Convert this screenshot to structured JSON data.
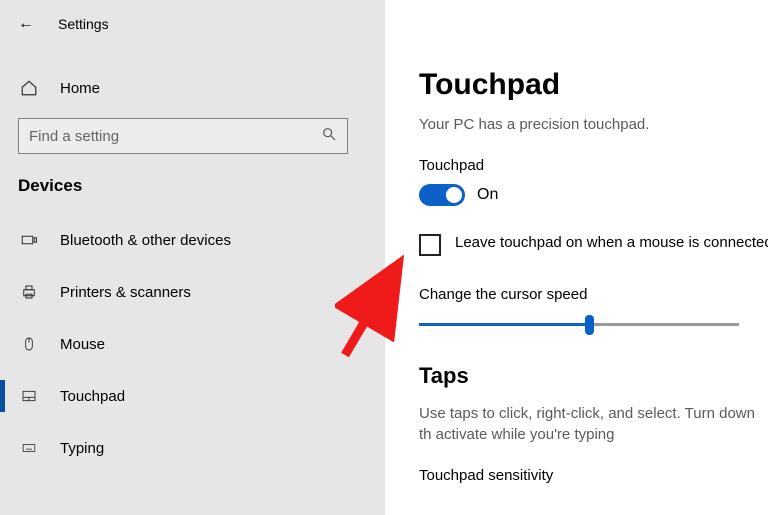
{
  "top": {
    "title": "Settings"
  },
  "home_label": "Home",
  "search": {
    "placeholder": "Find a setting"
  },
  "sidebar": {
    "section": "Devices",
    "items": [
      {
        "label": "Bluetooth & other devices"
      },
      {
        "label": "Printers & scanners"
      },
      {
        "label": "Mouse"
      },
      {
        "label": "Touchpad"
      },
      {
        "label": "Typing"
      }
    ]
  },
  "main": {
    "title": "Touchpad",
    "subtitle": "Your PC has a precision touchpad.",
    "toggle_label": "Touchpad",
    "toggle_state": "On",
    "checkbox_label": "Leave touchpad on when a mouse is connected",
    "cursor_label": "Change the cursor speed",
    "taps_heading": "Taps",
    "taps_desc": "Use taps to click, right-click, and select. Turn down th activate while you're typing",
    "sensitivity_label": "Touchpad sensitivity"
  }
}
